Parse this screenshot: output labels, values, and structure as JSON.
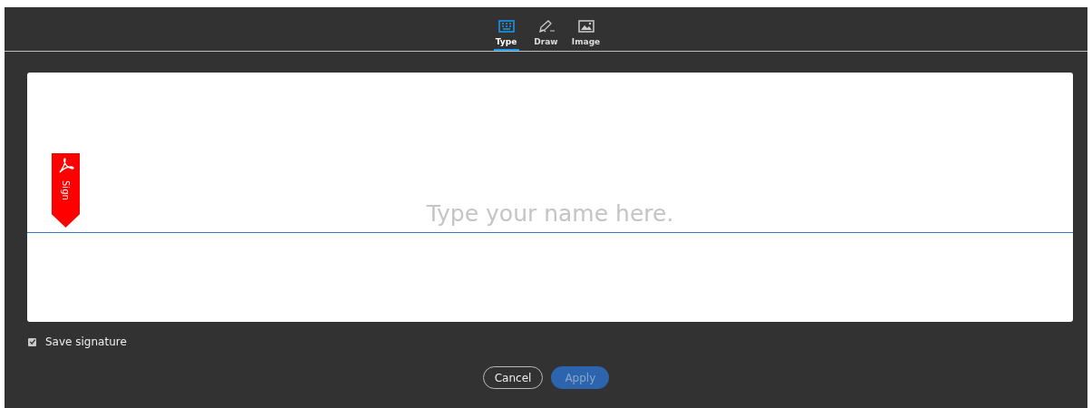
{
  "tabs": [
    {
      "label": "Type",
      "kind": "keyboard",
      "selected": true
    },
    {
      "label": "Draw",
      "kind": "pen",
      "selected": false
    },
    {
      "label": "Image",
      "kind": "image",
      "selected": false
    }
  ],
  "signature_field": {
    "placeholder": "Type your name here."
  },
  "sign_flag": {
    "label": "Sign"
  },
  "save_signature": {
    "label": "Save signature",
    "checked": true
  },
  "buttons": [
    {
      "label": "Cancel",
      "kind": "secondary",
      "disabled": false
    },
    {
      "label": "Apply",
      "kind": "primary",
      "disabled": true
    }
  ]
}
